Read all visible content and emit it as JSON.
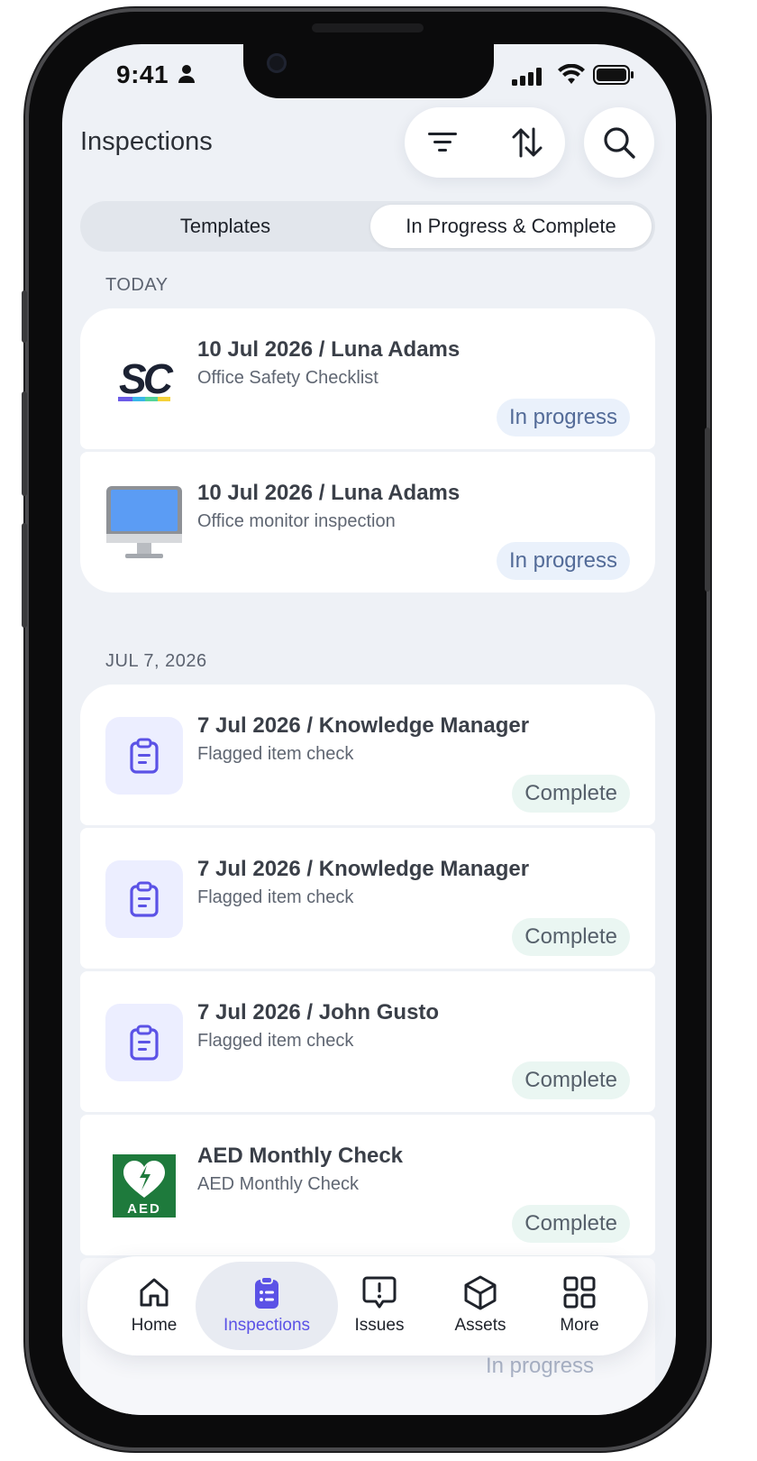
{
  "status_bar": {
    "time": "9:41"
  },
  "header": {
    "title": "Inspections"
  },
  "tabs": {
    "templates": "Templates",
    "in_progress_complete": "In Progress & Complete",
    "active": "In Progress & Complete"
  },
  "sections": [
    {
      "label": "TODAY"
    },
    {
      "label": "JUL 7, 2026"
    }
  ],
  "cards": [
    {
      "title": "10 Jul 2026 / Luna Adams",
      "subtitle": "Office Safety Checklist",
      "status": "In progress",
      "thumb_text": "SC"
    },
    {
      "title": "10 Jul 2026 / Luna Adams",
      "subtitle": "Office monitor inspection",
      "status": "In progress"
    },
    {
      "title": "7 Jul 2026 / Knowledge Manager",
      "subtitle": "Flagged item check",
      "status": "Complete"
    },
    {
      "title": "7 Jul 2026 / Knowledge Manager",
      "subtitle": "Flagged item check",
      "status": "Complete"
    },
    {
      "title": "7 Jul 2026 / John Gusto",
      "subtitle": "Flagged item check",
      "status": "Complete"
    },
    {
      "title": "AED Monthly Check",
      "subtitle": "AED Monthly Check",
      "status": "Complete",
      "thumb_text": "AED"
    }
  ],
  "partial_card": {
    "status": "In progress"
  },
  "nav": [
    {
      "label": "Home",
      "icon": "home-icon"
    },
    {
      "label": "Inspections",
      "icon": "inspections-icon"
    },
    {
      "label": "Issues",
      "icon": "issues-icon"
    },
    {
      "label": "Assets",
      "icon": "assets-icon"
    },
    {
      "label": "More",
      "icon": "more-grid-icon"
    }
  ],
  "colors": {
    "accent": "#5b52e6",
    "progress_badge": "#eaf1fb",
    "complete_badge": "#eaf6f2",
    "screen_bg": "#eef1f6"
  }
}
